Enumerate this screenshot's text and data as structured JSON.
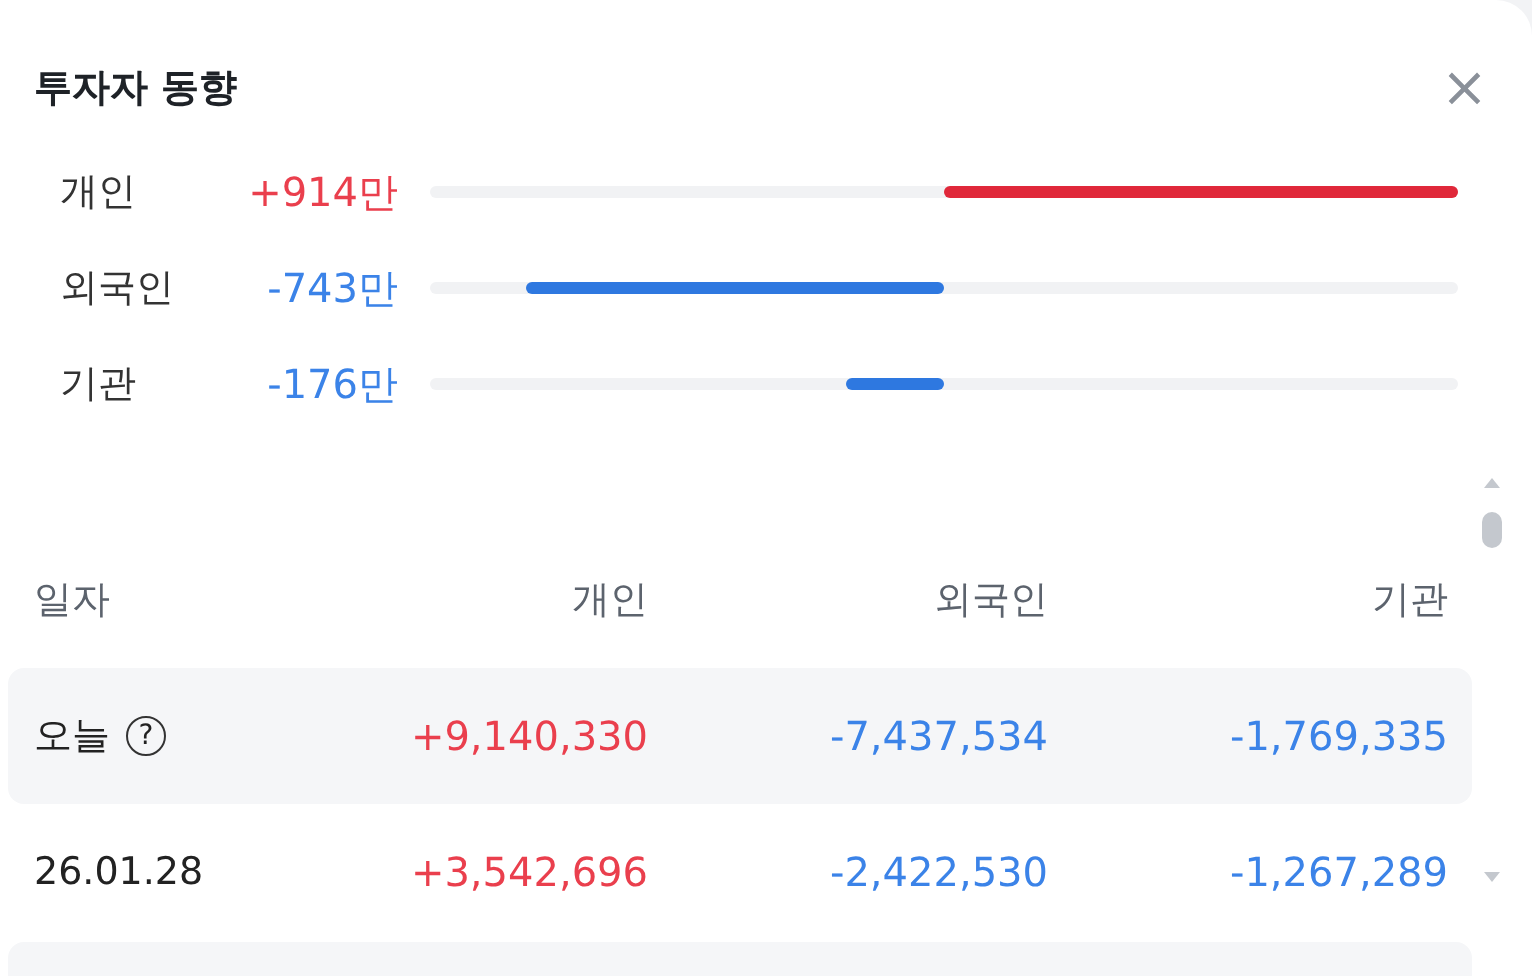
{
  "panel": {
    "title": "투자자 동향",
    "close": "×"
  },
  "investors": [
    {
      "name": "개인",
      "value": "+914만",
      "kind": "buy"
    },
    {
      "name": "외국인",
      "value": "-743만",
      "kind": "sell"
    },
    {
      "name": "기관",
      "value": "-176만",
      "kind": "sell"
    }
  ],
  "table": {
    "columns": [
      "일자",
      "개인",
      "외국인",
      "기관"
    ],
    "rows": [
      {
        "cells": [
          {
            "text": "오늘",
            "help": "?",
            "kind": "date"
          },
          {
            "text": "+9,140,330",
            "kind": "buy"
          },
          {
            "text": "-7,437,534",
            "kind": "sell"
          },
          {
            "text": "-1,769,335",
            "kind": "sell"
          }
        ]
      },
      {
        "cells": [
          {
            "text": "26.01.28",
            "kind": "date"
          },
          {
            "text": "+3,542,696",
            "kind": "buy"
          },
          {
            "text": "-2,422,530",
            "kind": "sell"
          },
          {
            "text": "-1,267,289",
            "kind": "sell"
          }
        ]
      }
    ]
  }
}
